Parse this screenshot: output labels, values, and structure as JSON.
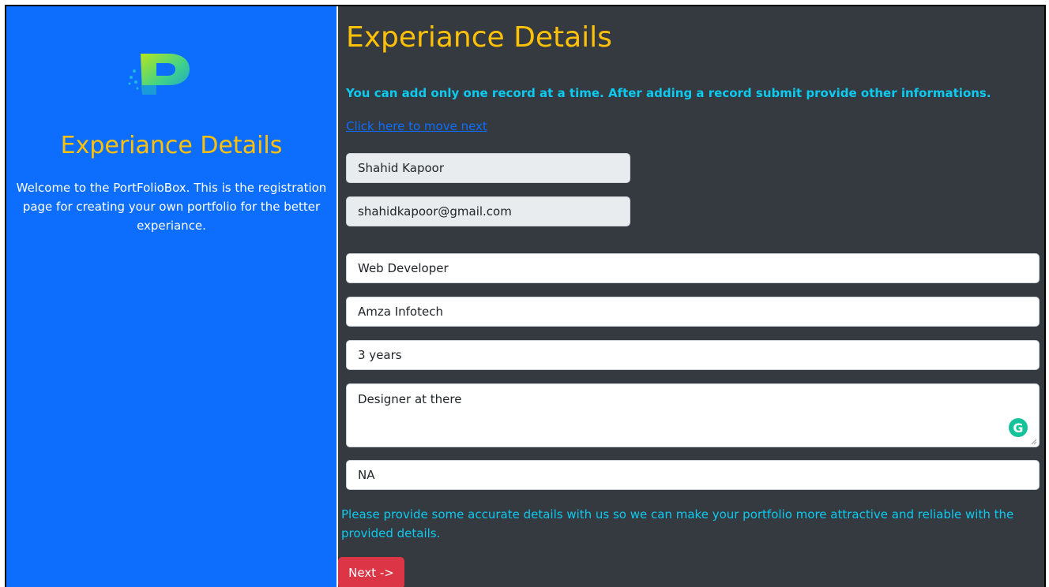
{
  "sidebar": {
    "logo_icon": "portfoliobox-logo-icon",
    "title": "Experiance Details",
    "description": "Welcome to the PortFolioBox. This is the registration page for creating your own portfolio for the better experiance."
  },
  "main": {
    "title": "Experiance Details",
    "notice": "You can add only one record at a time. After adding a record submit provide other informations.",
    "next_link": "Click here to move next",
    "fields": {
      "name": "Shahid Kapoor",
      "email": "shahidkapoor@gmail.com",
      "role": "Web Developer",
      "company": "Amza Infotech",
      "duration": "3 years",
      "description": "Designer at there",
      "other": "NA"
    },
    "footer_note": "Please provide some accurate details with us so we can make your portfolio more attractive and reliable with the provided details.",
    "next_button": "Next ->",
    "grammarly_icon": "grammarly-icon"
  },
  "colors": {
    "sidebar_bg": "#0d6efd",
    "main_bg": "#343a40",
    "title": "#ffc107",
    "info": "#0dcaf0",
    "button": "#dc3545"
  }
}
